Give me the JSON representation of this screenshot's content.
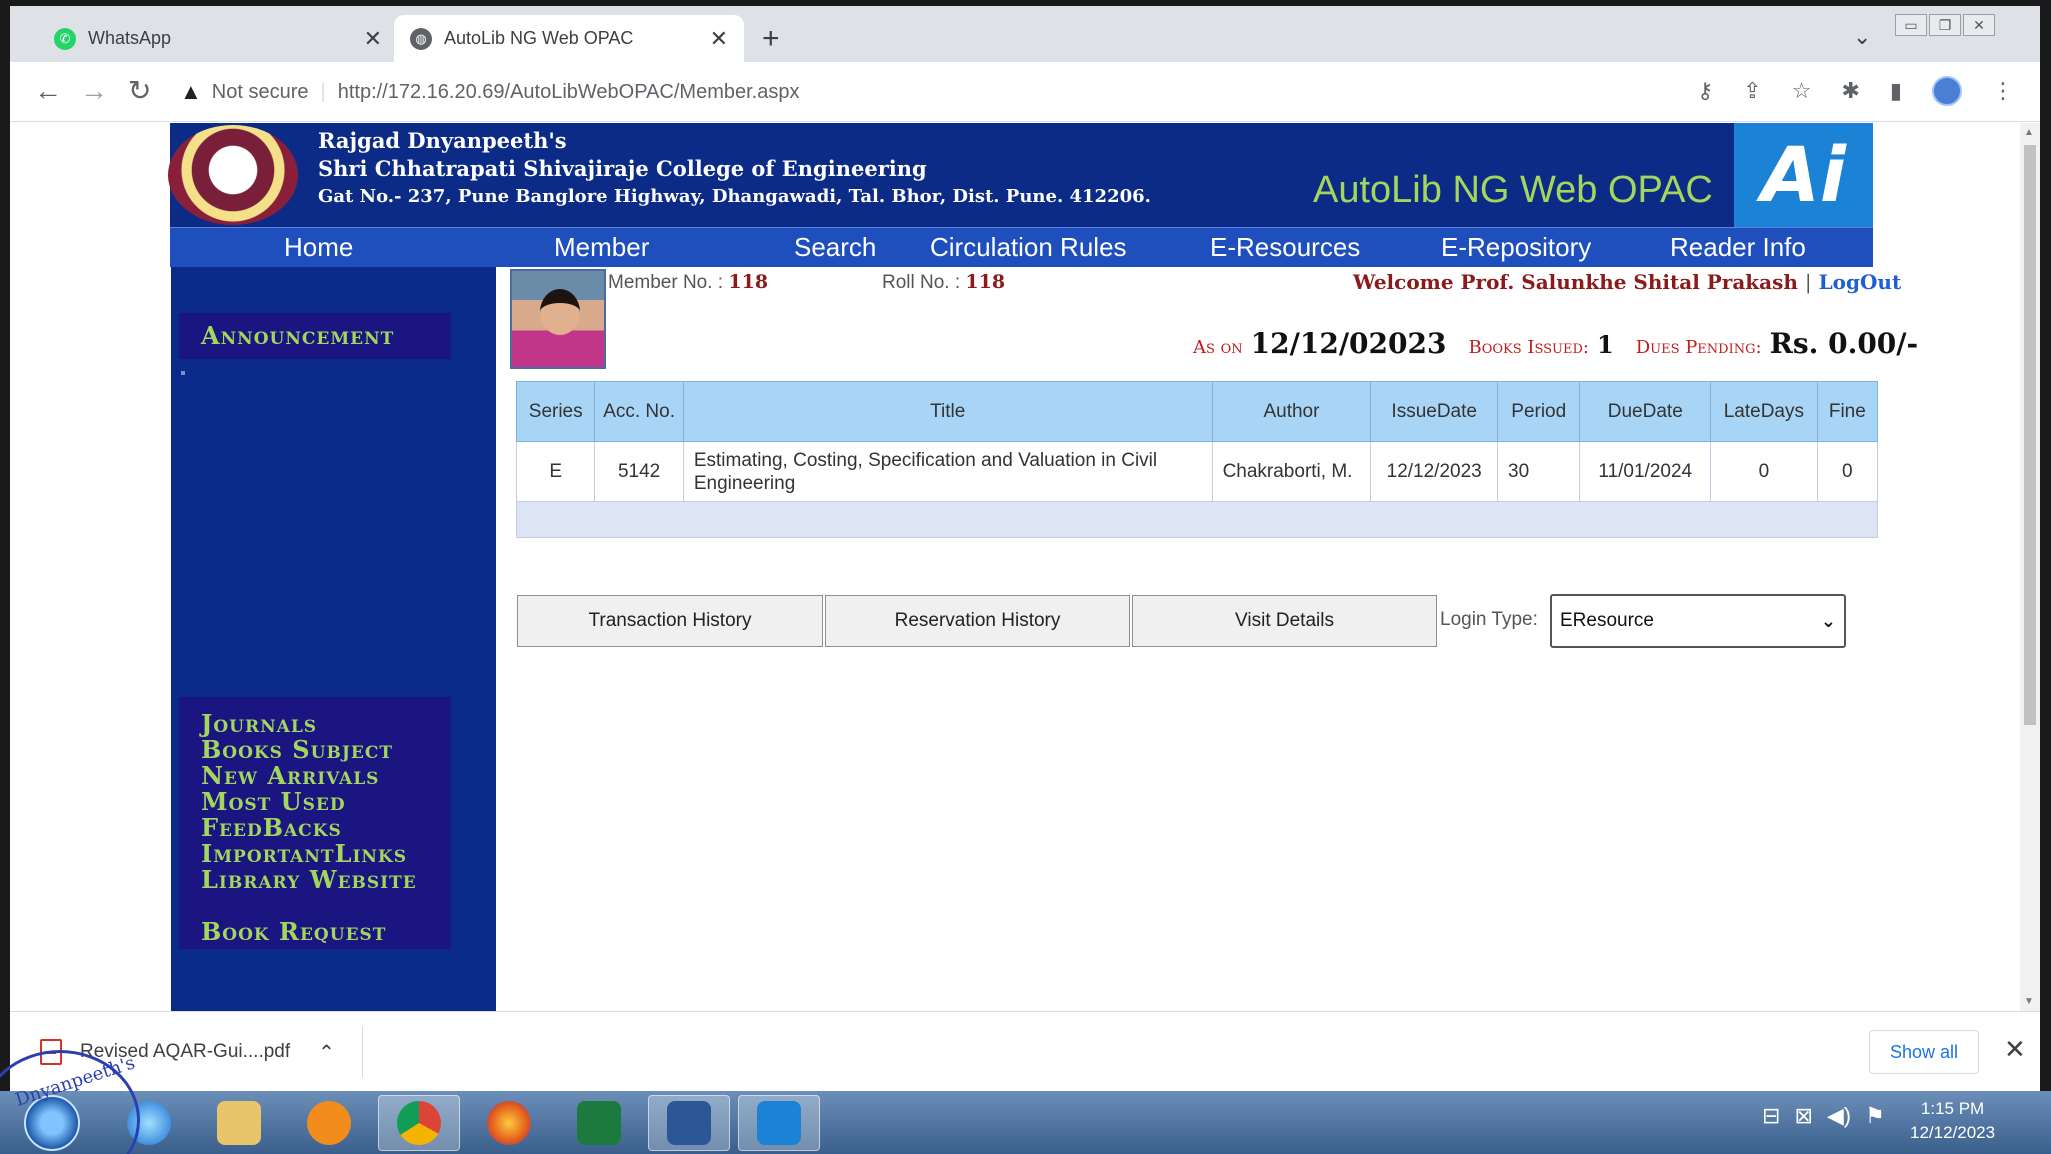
{
  "browser": {
    "tabs": [
      {
        "title": "WhatsApp",
        "favicon": "whatsapp-icon",
        "active": false
      },
      {
        "title": "AutoLib NG Web OPAC",
        "favicon": "globe-icon",
        "active": true
      }
    ],
    "security_label": "Not secure",
    "url": "http://172.16.20.69/AutoLibWebOPAC/Member.aspx"
  },
  "site": {
    "college_line1": "Rajgad Dnyanpeeth's",
    "college_line2": "Shri Chhatrapati Shivajiraje College of Engineering",
    "college_line3": "Gat No.- 237, Pune Banglore Highway, Dhangawadi, Tal. Bhor, Dist. Pune. 412206.",
    "opac_title": "AutoLib NG Web OPAC",
    "logo_text": "Ai",
    "nav": [
      "Home",
      "Member",
      "Search",
      "Circulation Rules",
      "E-Resources",
      "E-Repository",
      "Reader Info"
    ]
  },
  "sidebar": {
    "announcement": "Announcement",
    "links": [
      "Journals",
      "Books Subject",
      "New Arrivals",
      "Most Used",
      "FeedBacks",
      "ImportantLinks",
      "Library Website"
    ],
    "book_request": "Book Request"
  },
  "member": {
    "member_no_label": "Member No. :",
    "member_no": "118",
    "roll_no_label": "Roll No. :",
    "roll_no": "118",
    "welcome": "Welcome Prof. Salunkhe Shital Prakash",
    "separator": "|",
    "logout": "LogOut",
    "as_on_label": "As on",
    "as_on": "12/12/02023",
    "books_issued_label": "Books Issued:",
    "books_issued": "1",
    "dues_label": "Dues Pending:",
    "dues": "Rs. 0.00/-"
  },
  "issues": {
    "headers": [
      "Series",
      "Acc. No.",
      "Title",
      "Author",
      "IssueDate",
      "Period",
      "DueDate",
      "LateDays",
      "Fine"
    ],
    "rows": [
      {
        "series": "E",
        "acc_no": "5142",
        "title": "Estimating, Costing, Specification and Valuation in Civil Engineering",
        "author": "Chakraborti, M.",
        "issue_date": "12/12/2023",
        "period": "30",
        "due_date": "11/01/2024",
        "late_days": "0",
        "fine": "0"
      }
    ]
  },
  "actions": {
    "transaction_history": "Transaction History",
    "reservation_history": "Reservation History",
    "visit_details": "Visit Details",
    "login_type_label": "Login Type:",
    "login_type_value": "EResource"
  },
  "download_bar": {
    "file": "Revised AQAR-Gui....pdf",
    "show_all": "Show all"
  },
  "taskbar": {
    "time": "1:15 PM",
    "date": "12/12/2023",
    "stamp_text": "Dnyanpeeth's"
  }
}
